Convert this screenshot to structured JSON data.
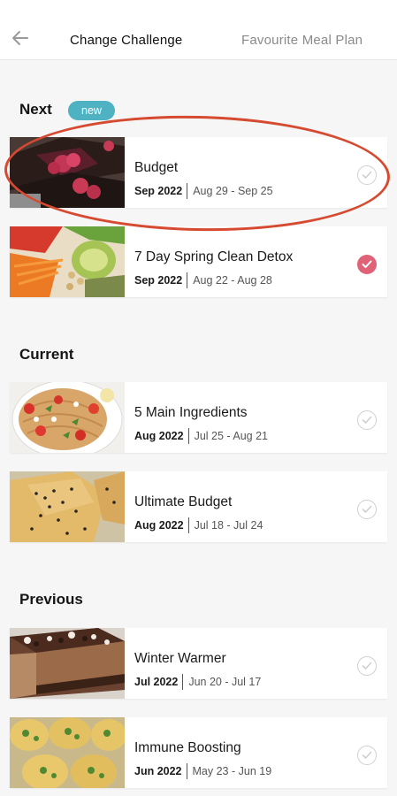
{
  "header": {
    "active_tab": "Change Challenge",
    "inactive_tab": "Favourite Meal Plan"
  },
  "sections": {
    "next": {
      "title": "Next",
      "badge": "new"
    },
    "current": {
      "title": "Current"
    },
    "previous": {
      "title": "Previous"
    }
  },
  "cards": [
    {
      "title": "Budget",
      "month": "Sep 2022",
      "range": "Aug 29 - Sep 25",
      "completed": false,
      "icon": "raspberry-bars"
    },
    {
      "title": "7 Day Spring Clean Detox",
      "month": "Sep 2022",
      "range": "Aug 22 - Aug 28",
      "completed": true,
      "icon": "salad-bowl"
    },
    {
      "title": "5 Main Ingredients",
      "month": "Aug 2022",
      "range": "Jul 25 - Aug 21",
      "completed": false,
      "icon": "pasta-plate"
    },
    {
      "title": "Ultimate Budget",
      "month": "Aug 2022",
      "range": "Jul 18 - Jul 24",
      "completed": false,
      "icon": "sesame-rolls"
    },
    {
      "title": "Winter Warmer",
      "month": "Jul 2022",
      "range": "Jun 20 - Jul 17",
      "completed": false,
      "icon": "chocolate-cheesecake"
    },
    {
      "title": "Immune Boosting",
      "month": "Jun 2022",
      "range": "May 23 - Jun 19",
      "completed": false,
      "icon": "egg-cups"
    }
  ],
  "colors": {
    "badge": "#4fb2c3",
    "check_done": "#e06277",
    "highlight": "#d54a30"
  }
}
